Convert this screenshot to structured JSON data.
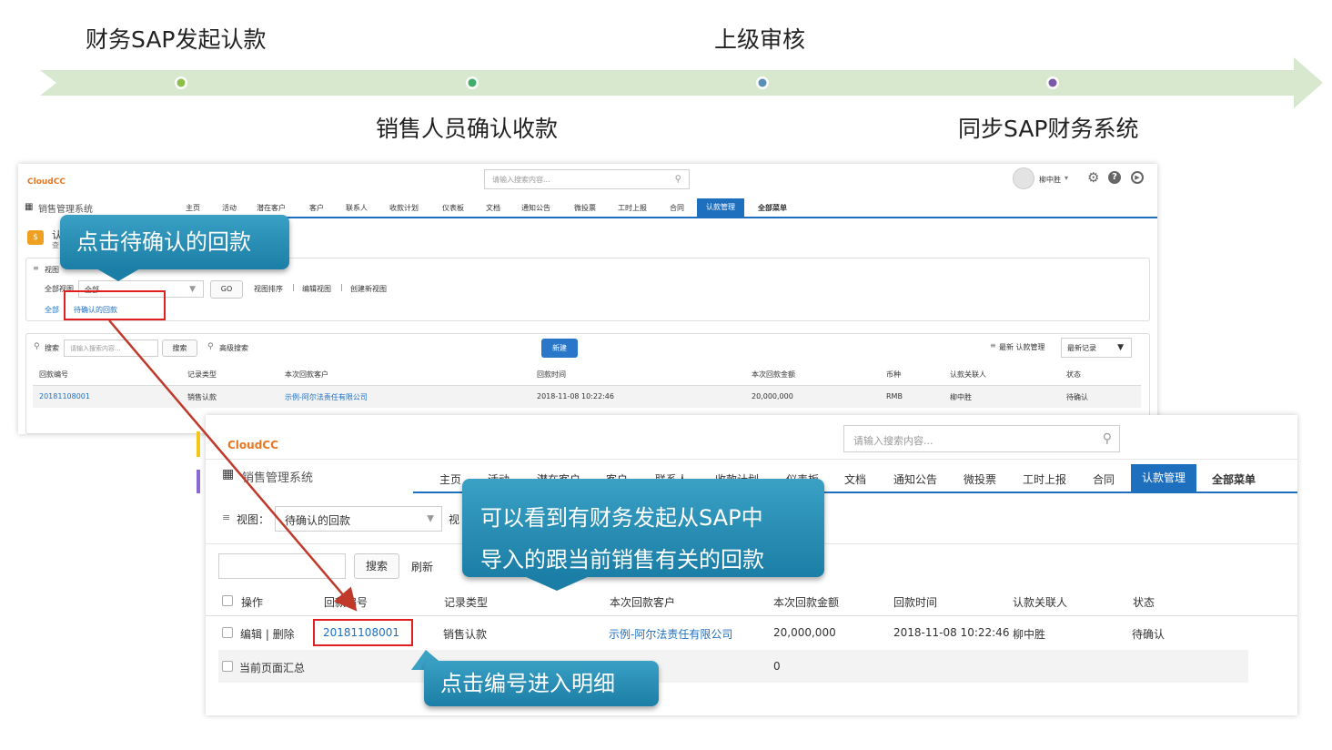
{
  "timeline": {
    "steps": [
      {
        "label": "财务SAP发起认款",
        "dot_color": "#8bbf4a"
      },
      {
        "label": "销售人员确认收款",
        "dot_color": "#3fae6a"
      },
      {
        "label": "上级审核",
        "dot_color": "#5a8fb8"
      },
      {
        "label": "同步SAP财务系统",
        "dot_color": "#7a5aa8"
      }
    ],
    "arrow_color": "#d8e8cf"
  },
  "panel1": {
    "logo": "CloudCC",
    "search_placeholder": "请输入搜索内容...",
    "user_name": "柳中胜",
    "app_name": "销售管理系统",
    "menu": [
      "主页",
      "活动",
      "潜在客户",
      "客户",
      "联系人",
      "收款计划",
      "仪表板",
      "文档",
      "通知公告",
      "微投票",
      "工时上报",
      "合同",
      "认款管理",
      "全部菜单"
    ],
    "page_title_short": "认",
    "page_subtitle_short": "查",
    "view_section_label": "视图",
    "all_views_label": "全部视图",
    "view_select_value": "全部",
    "go_button": "GO",
    "view_links": [
      "视图排序",
      "编辑视图",
      "创建新视图"
    ],
    "filter_all": "全部",
    "filter_pending": "待确认的回款",
    "search_label": "搜索",
    "search_input_placeholder": "请输入搜索内容...",
    "search_button": "搜索",
    "advanced_search": "高级搜索",
    "new_button": "新建",
    "recent_label": "最新 认款管理",
    "recent_select": "最新记录",
    "table": {
      "headers": [
        "回款编号",
        "记录类型",
        "本次回款客户",
        "回款时间",
        "本次回款金额",
        "币种",
        "认款关联人",
        "状态"
      ],
      "rows": [
        [
          "20181108001",
          "销售认款",
          "示例-阿尔法责任有限公司",
          "2018-11-08 10:22:46",
          "20,000,000",
          "RMB",
          "柳中胜",
          "待确认"
        ]
      ]
    }
  },
  "panel2": {
    "logo": "CloudCC",
    "search_placeholder": "请输入搜索内容...",
    "app_name": "销售管理系统",
    "menu": [
      "主页",
      "活动",
      "潜在客户",
      "客户",
      "联系人",
      "收款计划",
      "仪表板",
      "文档",
      "通知公告",
      "微投票",
      "工时上报",
      "合同",
      "认款管理",
      "全部菜单"
    ],
    "view_label": "视图：",
    "view_select_value": "待确认的回款",
    "view_more_short": "视",
    "search_button": "搜索",
    "refresh": "刷新",
    "table": {
      "headers": [
        "操作",
        "回款编号",
        "记录类型",
        "本次回款客户",
        "本次回款金额",
        "回款时间",
        "认款关联人",
        "状态"
      ],
      "row": {
        "actions": "编辑 | 删除",
        "id": "20181108001",
        "type": "销售认款",
        "customer": "示例-阿尔法责任有限公司",
        "amount": "20,000,000",
        "time": "2018-11-08 10:22:46",
        "person": "柳中胜",
        "status": "待确认"
      },
      "summary_label": "当前页面汇总",
      "summary_amount": "0"
    }
  },
  "callouts": {
    "click_pending": "点击待确认的回款",
    "see_sap_line1": "可以看到有财务发起从SAP中",
    "see_sap_line2": "导入的跟当前销售有关的回款",
    "click_id": "点击编号进入明细"
  },
  "colors": {
    "accent_blue": "#1f6fbf",
    "logo_orange": "#e87722",
    "callout_teal": "#2a8fb5",
    "highlight_red": "#e02020"
  }
}
